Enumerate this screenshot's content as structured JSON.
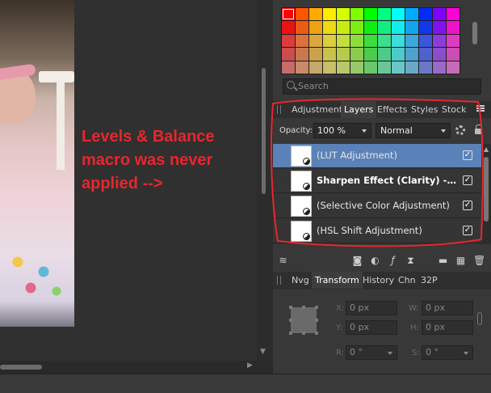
{
  "annotation": {
    "line1": "Levels & Balance",
    "line2": "macro was never",
    "line3": "applied -->"
  },
  "colors": {
    "annotation_red": "#e8262e",
    "selection_blue": "#5b82b8"
  },
  "search": {
    "placeholder": "Search"
  },
  "panel_tabs": {
    "items": [
      {
        "label": "Adjustment"
      },
      {
        "label": "Layers"
      },
      {
        "label": "Effects"
      },
      {
        "label": "Styles"
      },
      {
        "label": "Stock"
      }
    ],
    "active": "Layers"
  },
  "layers_toolbar": {
    "opacity_label": "Opacity:",
    "opacity_value": "100 %",
    "blend_mode": "Normal"
  },
  "layers": [
    {
      "name": "(LUT Adjustment)",
      "selected": true,
      "bold": false,
      "visible": true
    },
    {
      "name": "Sharpen Effect (Clarity) - Ha...",
      "selected": false,
      "bold": true,
      "visible": true
    },
    {
      "name": "(Selective Color Adjustment)",
      "selected": false,
      "bold": false,
      "visible": true
    },
    {
      "name": "(HSL Shift Adjustment)",
      "selected": false,
      "bold": false,
      "visible": true
    }
  ],
  "lower_tabs": {
    "items": [
      {
        "label": "Nvg"
      },
      {
        "label": "Transform"
      },
      {
        "label": "History"
      },
      {
        "label": "Chn"
      },
      {
        "label": "32P"
      }
    ],
    "active": "Transform"
  },
  "transform": {
    "x_label": "X:",
    "x_value": "0 px",
    "y_label": "Y:",
    "y_value": "0 px",
    "w_label": "W:",
    "w_value": "0 px",
    "h_label": "H:",
    "h_value": "0 px",
    "r_label": "R:",
    "r_value": "0 °",
    "s_label": "S:",
    "s_value": "0 °"
  },
  "icons": {
    "search": "search-icon",
    "menu": "panel-menu-icon",
    "gear": "gear-icon",
    "lock": "lock-icon",
    "link": "link-icon"
  }
}
